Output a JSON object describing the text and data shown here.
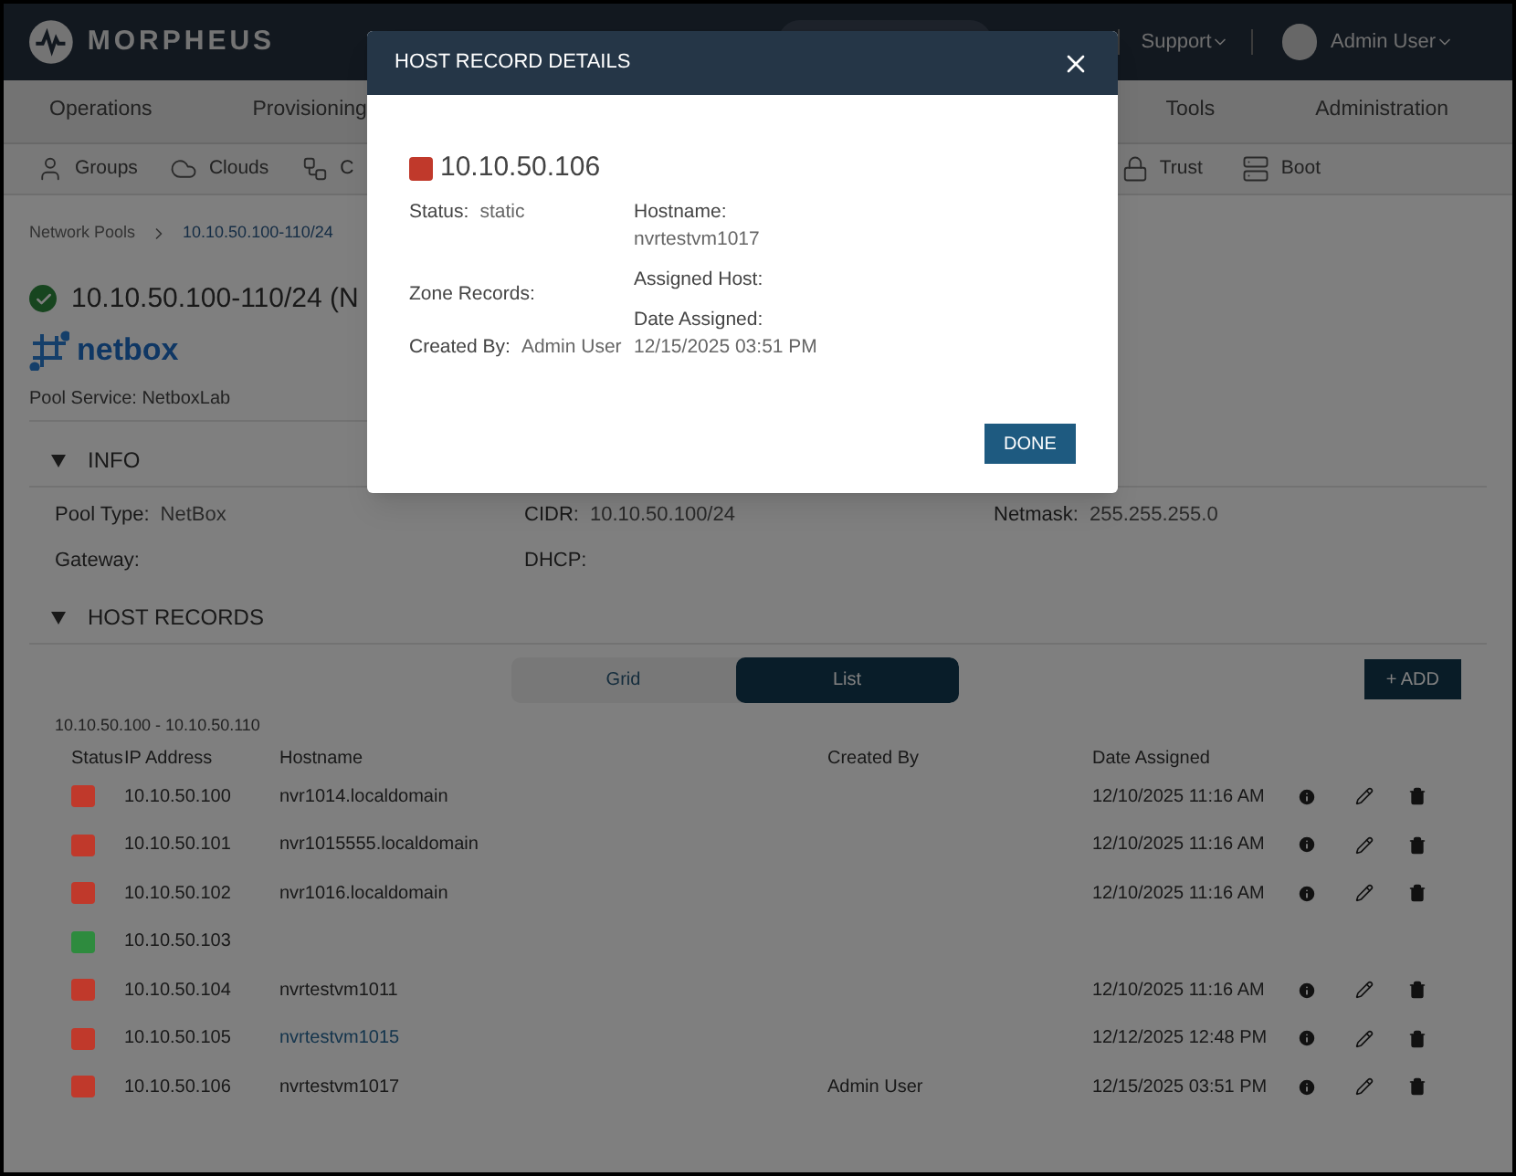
{
  "header": {
    "brand": "MORPHEUS",
    "support": "Support",
    "user": "Admin User"
  },
  "nav": {
    "left": [
      "Operations",
      "Provisioning"
    ],
    "right": [
      "Tools",
      "Administration"
    ]
  },
  "subnav": {
    "left": [
      "Groups",
      "Clouds",
      "C"
    ],
    "right": [
      "Trust",
      "Boot"
    ]
  },
  "breadcrumb": {
    "parent": "Network Pools",
    "current": "10.10.50.100-110/24"
  },
  "pool": {
    "title": "10.10.50.100-110/24 (N",
    "logo": "netbox",
    "service": "Pool Service: NetboxLab"
  },
  "info": {
    "heading": "INFO",
    "expanded": true,
    "fields": [
      {
        "label": "Pool Type:",
        "value": "NetBox"
      },
      {
        "label": "CIDR:",
        "value": "10.10.50.100/24"
      },
      {
        "label": "Netmask:",
        "value": "255.255.255.0"
      },
      {
        "label": "Gateway:"
      },
      {
        "label": "DHCP:"
      }
    ]
  },
  "host_records": {
    "heading": "HOST RECORDS",
    "expanded": true,
    "views": [
      {
        "label": "Grid",
        "selected": false
      },
      {
        "label": "List",
        "selected": true
      }
    ],
    "add_button": "+ ADD",
    "range": "10.10.50.100 - 10.10.50.110",
    "columns": [
      "Status",
      "IP Address",
      "Hostname",
      "Created By",
      "Date Assigned"
    ],
    "rows": [
      {
        "color": "#c0392b",
        "ip": "10.10.50.100",
        "hostname": "nvr1014.localdomain",
        "link": false,
        "date": "12/10/2025 11:16 AM",
        "actions": true
      },
      {
        "color": "#c0392b",
        "ip": "10.10.50.101",
        "hostname": "nvr1015555.localdomain",
        "link": false,
        "date": "12/10/2025 11:16 AM",
        "actions": true
      },
      {
        "color": "#c0392b",
        "ip": "10.10.50.102",
        "hostname": "nvr1016.localdomain",
        "link": false,
        "date": "12/10/2025 11:16 AM",
        "actions": true
      },
      {
        "color": "#2e8b3e",
        "ip": "10.10.50.103",
        "actions": false
      },
      {
        "color": "#c0392b",
        "ip": "10.10.50.104",
        "hostname": "nvrtestvm1011",
        "link": false,
        "date": "12/10/2025 11:16 AM",
        "actions": true
      },
      {
        "color": "#c0392b",
        "ip": "10.10.50.105",
        "hostname": "nvrtestvm1015",
        "link": true,
        "date": "12/12/2025 12:48 PM",
        "actions": true
      },
      {
        "color": "#c0392b",
        "ip": "10.10.50.106",
        "hostname": "nvrtestvm1017",
        "link": false,
        "created_by": "Admin User",
        "date": "12/15/2025 03:51 PM",
        "actions": true
      }
    ]
  },
  "modal": {
    "title": "HOST RECORD DETAILS",
    "color": "#c0392b",
    "ip": "10.10.50.106",
    "left": [
      {
        "kind": "inline",
        "label": "Status:",
        "value": "static"
      },
      {
        "kind": "inline",
        "label": "Zone Records:"
      },
      {
        "kind": "inline",
        "label": "Created By:",
        "value": "Admin User"
      }
    ],
    "right": [
      {
        "kind": "stacked",
        "label": "Hostname:",
        "value": "nvrtestvm1017"
      },
      {
        "kind": "stacked",
        "label": "Assigned Host:"
      },
      {
        "kind": "stacked",
        "label": "Date Assigned:",
        "value": "12/15/2025 03:51 PM"
      }
    ],
    "done": "DONE"
  }
}
